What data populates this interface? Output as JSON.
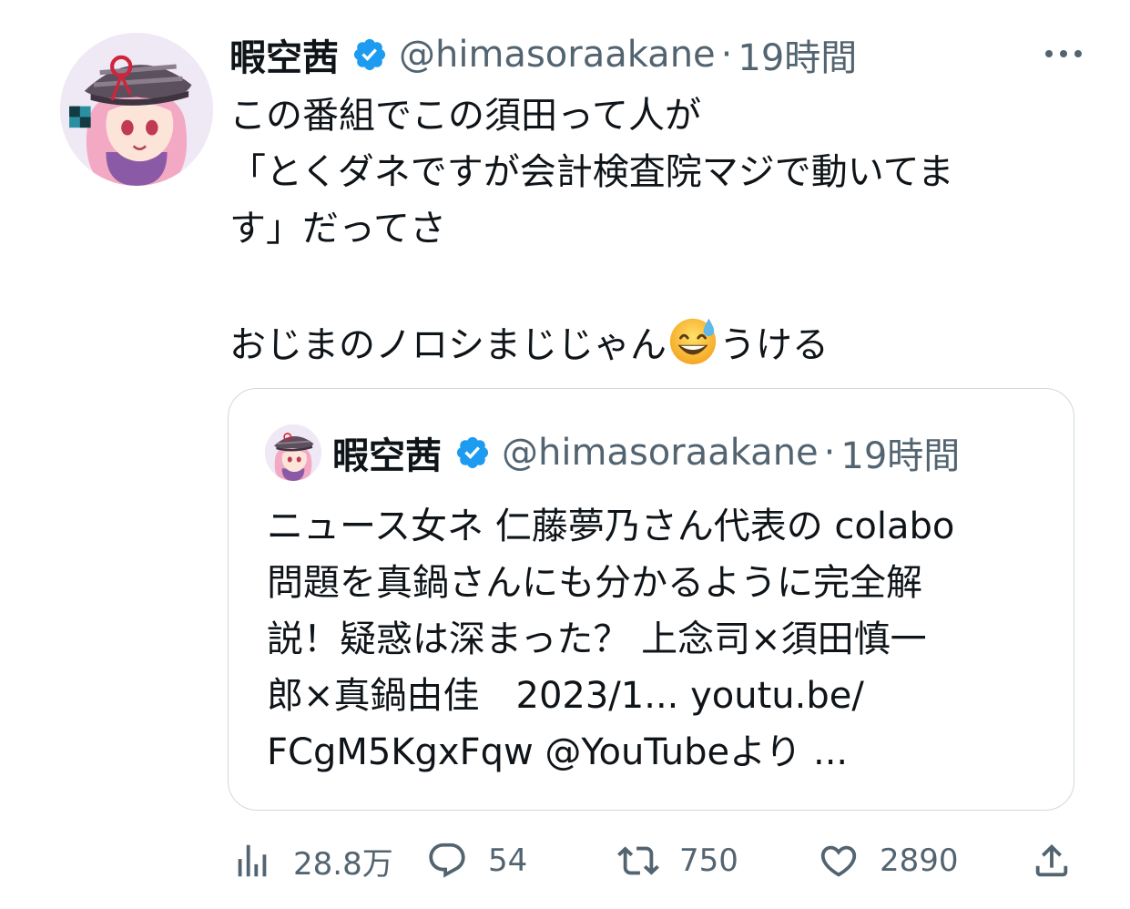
{
  "tweet": {
    "display_name": "暇空茜",
    "handle": "@himasoraakane",
    "separator": "·",
    "time": "19時間",
    "body": {
      "lines": [
        "この番組でこの須田って人が",
        "「とくダネですが会計検査院マジで動いてま",
        "す」だってさ",
        "",
        "おじまのノロシまじじゃん"
      ],
      "last_line_suffix": "うける",
      "emoji_name": "grinning-sweat-emoji"
    },
    "quote": {
      "display_name": "暇空茜",
      "handle": "@himasoraakane",
      "separator": "·",
      "time": "19時間",
      "lines": [
        "ニュース女ネ 仁藤夢乃さん代表の colabo",
        "問題を真鍋さんにも分かるように完全解",
        "説！疑惑は深まった？ 上念司×須田慎一",
        "郎×真鍋由佳　2023/1... youtu.be/",
        "FCgM5KgxFqw @YouTubeより ..."
      ]
    },
    "actions": {
      "views": "28.8万",
      "replies": "54",
      "retweets": "750",
      "likes": "2890"
    },
    "colors": {
      "verified": "#1d9bf0",
      "secondary_text": "#536471",
      "border": "#cfd9de"
    }
  }
}
